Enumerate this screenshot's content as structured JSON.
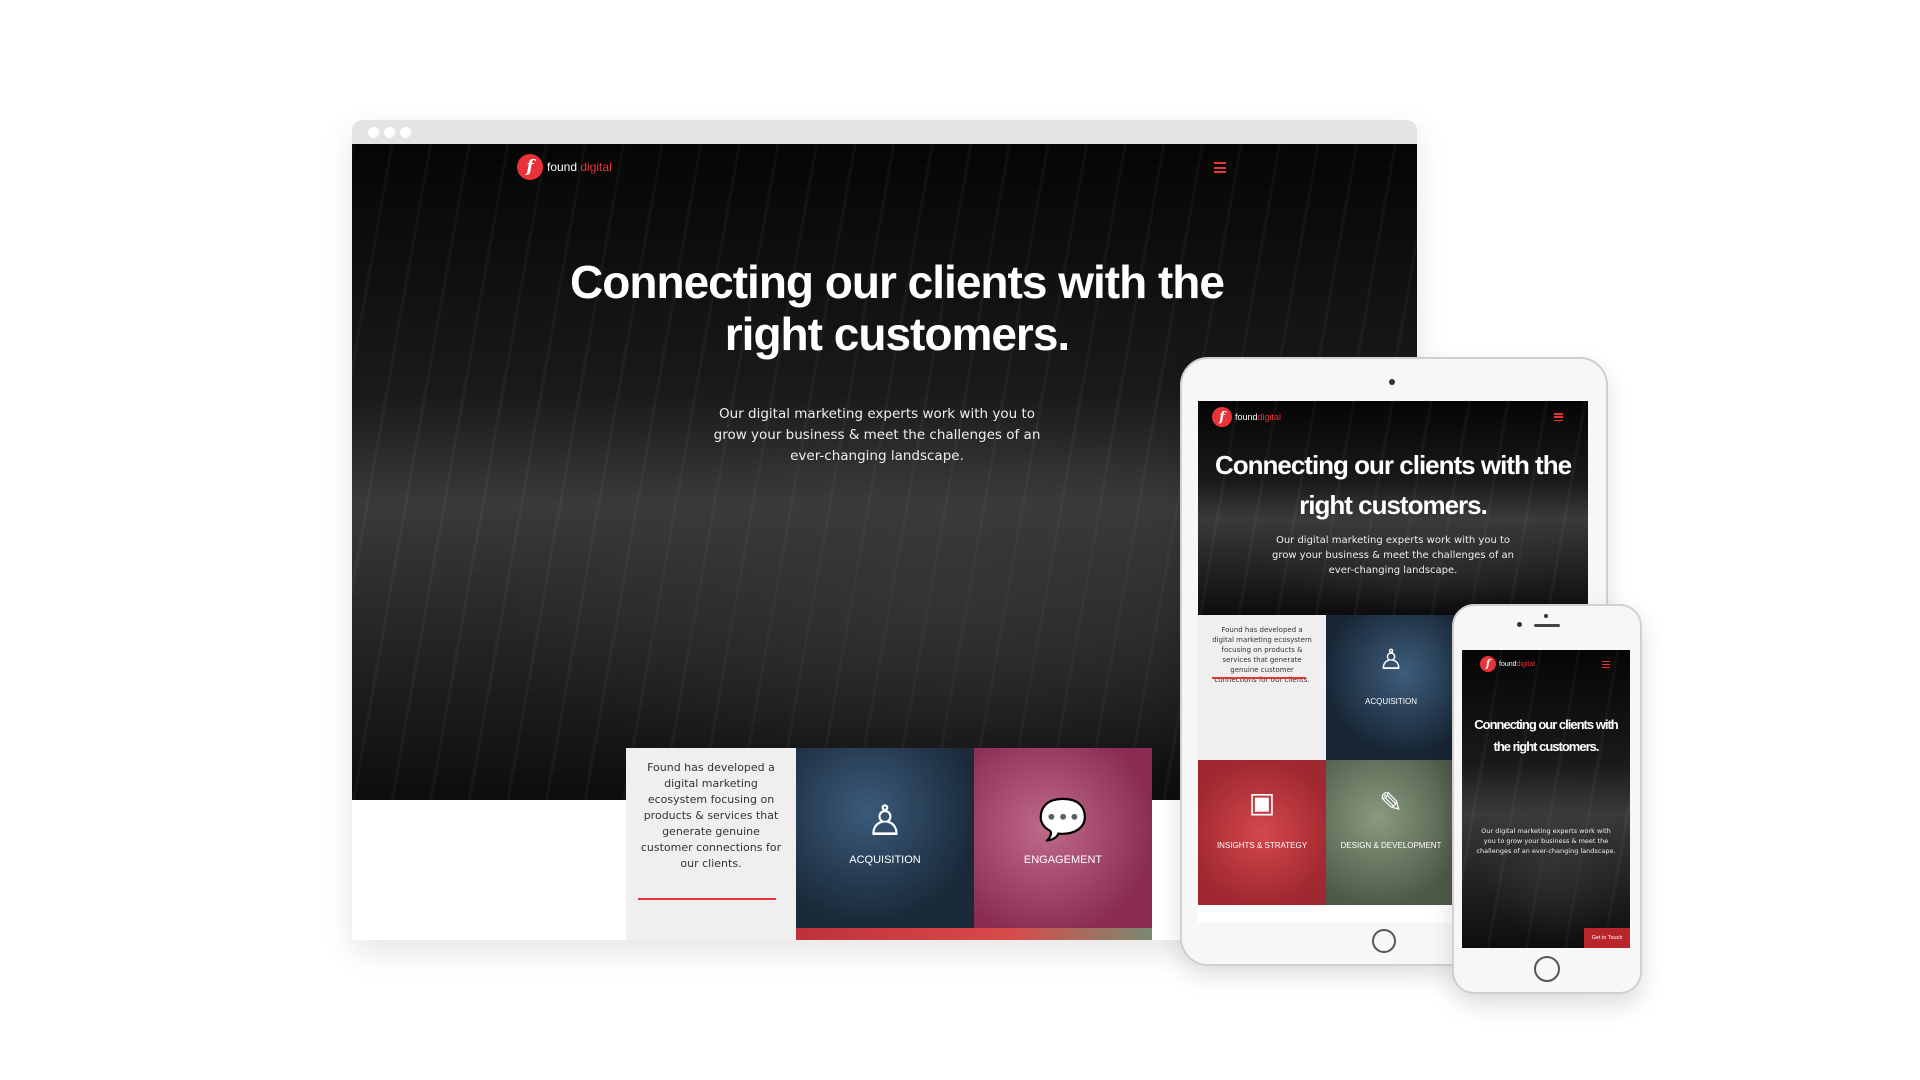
{
  "brand": {
    "logo_letter": "f",
    "name_part1": "found",
    "name_part2": "digital",
    "accent_color": "#e8333a"
  },
  "desktop": {
    "hero_title": "Connecting our clients with the right customers.",
    "hero_subtitle": "Our digital marketing experts work with you to grow your business & meet the challenges of an ever-changing landscape.",
    "intro_text": "Found has developed a digital marketing ecosystem focusing on products & services that generate genuine customer connections for our clients.",
    "tiles": [
      {
        "label": "ACQUISITION",
        "icon": "person-dollar-icon"
      },
      {
        "label": "ENGAGEMENT",
        "icon": "chat-bubbles-icon"
      }
    ]
  },
  "tablet": {
    "hero_title": "Connecting our clients with the right customers.",
    "hero_subtitle": "Our digital marketing experts work with you to grow your business & meet the challenges of an ever-changing landscape.",
    "intro_text": "Found has developed a digital marketing ecosystem focusing on products & services that generate genuine customer connections for our clients.",
    "tiles": [
      {
        "label": "ACQUISITION",
        "icon": "person-dollar-icon"
      },
      {
        "label": "INSIGHTS & STRATEGY",
        "icon": "presentation-board-icon"
      },
      {
        "label": "DESIGN & DEVELOPMENT",
        "icon": "pencil-edit-icon"
      }
    ]
  },
  "phone": {
    "hero_title": "Connecting our clients with the right customers.",
    "hero_subtitle": "Our digital marketing experts work with you to grow your business & meet the challenges of an ever-changing landscape.",
    "cta_label": "Get in Touch"
  }
}
